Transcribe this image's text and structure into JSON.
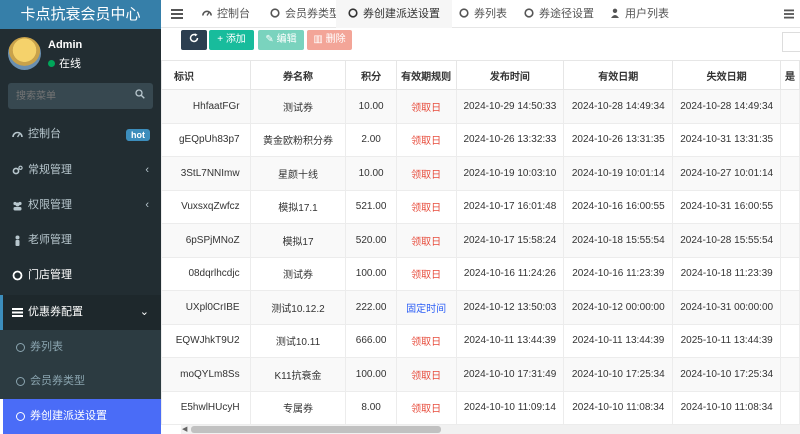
{
  "app_title": "卡点抗衰会员中心",
  "user": {
    "name": "Admin",
    "status": "在线"
  },
  "search": {
    "placeholder": "搜索菜单"
  },
  "menu": {
    "dashboard": "控制台",
    "dashboard_badge": "hot",
    "general": "常规管理",
    "permission": "权限管理",
    "teacher": "老师管理",
    "store": "门店管理",
    "coupon_config": "优惠券配置",
    "coupon_list": "券列表",
    "member_coupon_type": "会员券类型",
    "coupon_send": "券创建派送设置"
  },
  "tabs": [
    {
      "label": "控制台",
      "icon": "dashboard-icon"
    },
    {
      "label": "会员券类型",
      "icon": "circle-icon"
    },
    {
      "label": "券创建派送设置",
      "icon": "circle-icon"
    },
    {
      "label": "券列表",
      "icon": "circle-icon"
    },
    {
      "label": "券途径设置",
      "icon": "circle-icon"
    },
    {
      "label": "用户列表",
      "icon": "user-icon"
    }
  ],
  "toolbar": {
    "add": "添加",
    "edit": "编辑",
    "delete": "删除"
  },
  "table": {
    "headers": [
      "标识",
      "券名称",
      "积分",
      "有效期规则",
      "发布时间",
      "有效日期",
      "失效日期",
      "是"
    ],
    "rows": [
      [
        "HhfaatFGr",
        "测试券",
        "10.00",
        "领取日",
        "2024-10-29 14:50:33",
        "2024-10-28 14:49:34",
        "2024-10-28 14:49:34"
      ],
      [
        "gEQpUh83p7",
        "黄金欧粉积分券",
        "2.00",
        "领取日",
        "2024-10-26 13:32:33",
        "2024-10-26 13:31:35",
        "2024-10-31 13:31:35"
      ],
      [
        "3StL7NNImw",
        "星颜十线",
        "10.00",
        "领取日",
        "2024-10-19 10:03:10",
        "2024-10-19 10:01:14",
        "2024-10-27 10:01:14"
      ],
      [
        "VuxsxqZwfcz",
        "模拟17.1",
        "521.00",
        "领取日",
        "2024-10-17 16:01:48",
        "2024-10-16 16:00:55",
        "2024-10-31 16:00:55"
      ],
      [
        "6pSPjMNoZ",
        "模拟17",
        "520.00",
        "领取日",
        "2024-10-17 15:58:24",
        "2024-10-18 15:55:54",
        "2024-10-28 15:55:54"
      ],
      [
        "08dqrlhcdjc",
        "测试券",
        "100.00",
        "领取日",
        "2024-10-16 11:24:26",
        "2024-10-16 11:23:39",
        "2024-10-18 11:23:39"
      ],
      [
        "UXpl0CrIBE",
        "测试10.12.2",
        "222.00",
        "固定时间",
        "2024-10-12 13:50:03",
        "2024-10-12 00:00:00",
        "2024-10-31 00:00:00"
      ],
      [
        "EQWJhkT9U2",
        "测试10.11",
        "666.00",
        "领取日",
        "2024-10-11 13:44:39",
        "2024-10-11 13:44:39",
        "2025-10-11 13:44:39"
      ],
      [
        "moQYLm8Ss",
        "K11抗衰金",
        "100.00",
        "领取日",
        "2024-10-10 17:31:49",
        "2024-10-10 17:25:34",
        "2024-10-10 17:25:34"
      ],
      [
        "E5hwlHUcyH",
        "专属券",
        "8.00",
        "领取日",
        "2024-10-10 11:09:14",
        "2024-10-10 11:08:34",
        "2024-10-10 11:08:34"
      ]
    ]
  },
  "colors": {
    "sidebar_bg": "#222d32",
    "active_menu": "#4a6cf7",
    "rule_receive": "#e74c3c",
    "rule_fixed": "#2e60f6",
    "add_btn": "#18bc9c"
  }
}
